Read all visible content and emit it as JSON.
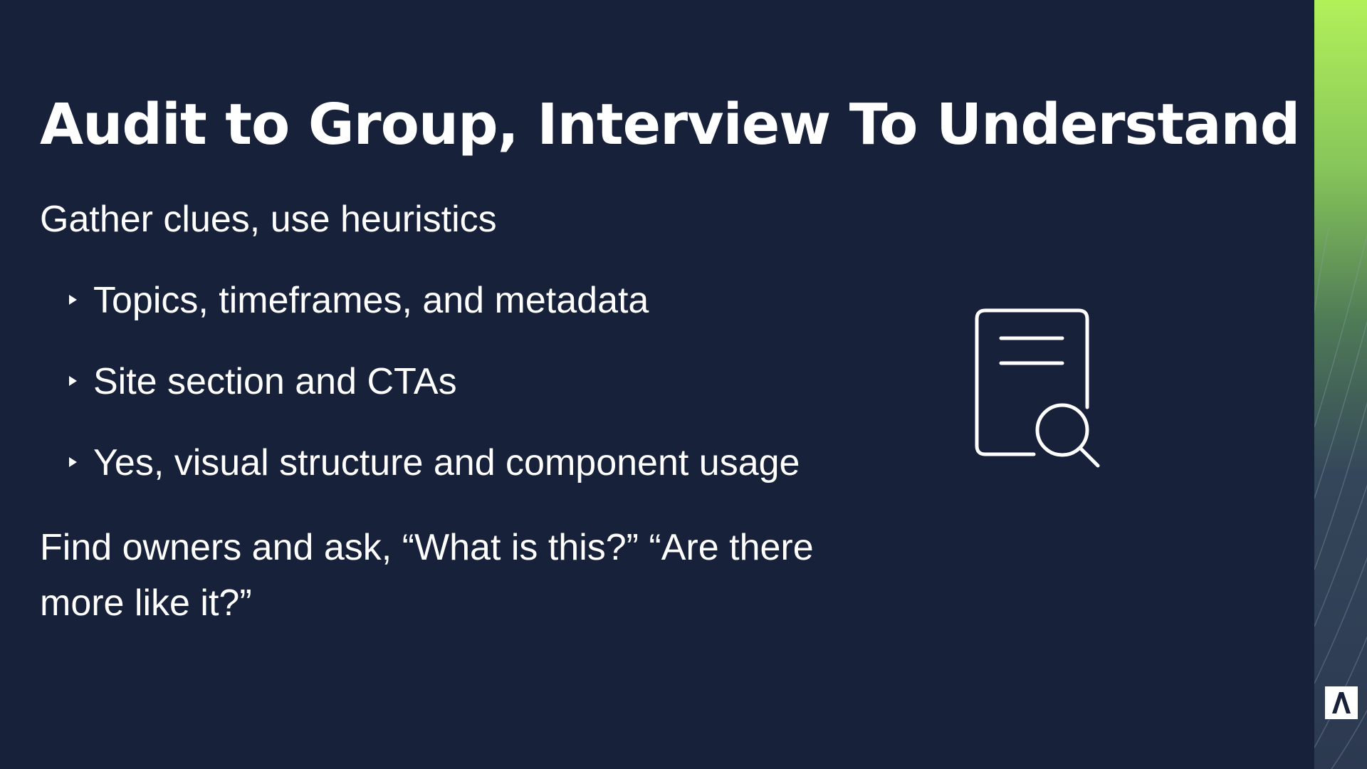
{
  "slide": {
    "title": "Audit to Group, Interview To Understand",
    "lead": "Gather clues, use heuristics",
    "bullets": [
      "Topics, timeframes, and metadata",
      "Site section and CTAs",
      "Yes, visual structure and component usage"
    ],
    "closing": "Find owners and ask, “What is this?” “Are there more like it?”"
  },
  "icons": {
    "illustration": "document-search-icon",
    "bullet": "triangle-bullet-icon",
    "logo": "brand-logo-icon"
  },
  "colors": {
    "background": "#17213a",
    "text": "#ffffff",
    "accent_top": "#b2f05a",
    "accent_bottom": "#2e3b52"
  }
}
